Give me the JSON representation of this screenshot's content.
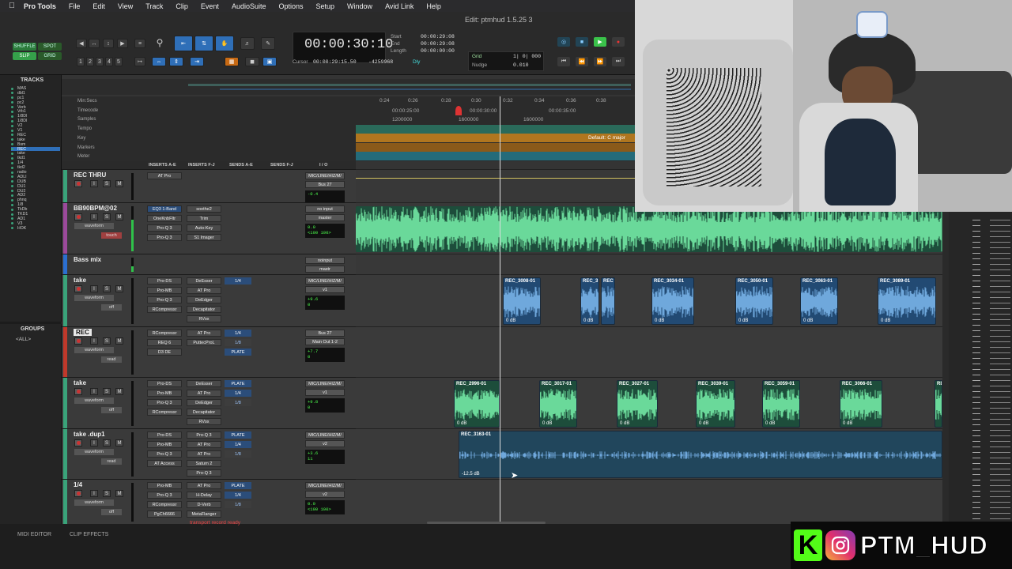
{
  "menubar": {
    "app": "Pro Tools",
    "items": [
      "File",
      "Edit",
      "View",
      "Track",
      "Clip",
      "Event",
      "AudioSuite",
      "Options",
      "Setup",
      "Window",
      "Avid Link",
      "Help"
    ]
  },
  "window": {
    "title": "Edit: ptmhud 1.5.25 3"
  },
  "toolbar": {
    "modes": [
      "SHUFFLE",
      "SPOT",
      "SLIP",
      "GRID"
    ],
    "zoom_presets": [
      "1",
      "2",
      "3",
      "4",
      "5"
    ],
    "main_counter": "00:00:30:10",
    "start_label": "Start",
    "start_value": "00:00:29:08",
    "end_label": "End",
    "end_value": "00:00:29:08",
    "length_label": "Length",
    "length_value": "00:00:00:00",
    "cursor_label": "Cursor",
    "cursor_value": "00:00:29:15.50",
    "sample_value": "-4259968",
    "dly_label": "Dly",
    "grid_label": "Grid",
    "grid_value": "1| 0| 000",
    "nudge_label": "Nudge",
    "nudge_value": "0.010"
  },
  "rulers": {
    "labels": [
      "Min:Secs",
      "Timecode",
      "Samples",
      "Tempo",
      "Key",
      "Markers",
      "Meter"
    ],
    "minsecs_ticks": [
      "0:24",
      "0:26",
      "0:28",
      "0:30",
      "0:32",
      "0:34",
      "0:36",
      "0:38"
    ],
    "timecode_ticks": [
      "00:00:25:00",
      "00:00:30:00",
      "00:00:35:00"
    ],
    "sample_ticks": [
      "1200000",
      "1600000",
      "1600000"
    ],
    "key_text": "Default: C major"
  },
  "column_headers": [
    "INSERTS A-E",
    "INSERTS F-J",
    "SENDS A-E",
    "SENDS F-J",
    "I / O"
  ],
  "panels": {
    "tracks": "TRACKS",
    "groups": "GROUPS",
    "groups_all": "<ALL>"
  },
  "track_list": [
    "MAS",
    "dbl1",
    "pc1",
    "pc2",
    "Verb",
    "Vrb1",
    "1/8DI",
    "1/8DI",
    "V2",
    "V1",
    "REC",
    "take",
    "Bsm",
    "REC",
    "take",
    "tkd1",
    "1/4",
    "tkd2",
    "radio",
    "ADLI",
    "DUB",
    "DU1",
    "DU2",
    "AD2",
    "phnq",
    "1/8",
    "TkDb",
    "TKD1",
    "AD1",
    "V3",
    "HOK"
  ],
  "tracks": [
    {
      "name": "REC THRU",
      "io_in": "MIC/LINE/HIZ/M/",
      "io_out": "Bus 27",
      "vol": "-0.4",
      "pan": "",
      "inserts": [
        "AT Pro"
      ],
      "inserts2": [],
      "color": "#3aa37a"
    },
    {
      "name": "BB90BPM@02",
      "io_in": "no input",
      "io_out": "master",
      "vol": "0.0",
      "pan": "<100  100>",
      "inserts": [
        "EQ3 1-Band",
        "OneKnbFltr",
        "Pro-Q 3",
        "Pro-Q 3"
      ],
      "inserts2": [
        "soothe2",
        "Trim",
        "Auto-Key",
        "S1 Imager"
      ],
      "color": "#9b4a9b",
      "view": "waveform",
      "auto": "touch"
    },
    {
      "name": "Bass mix",
      "io_in": "noinput",
      "io_out": "mastr",
      "vol": "0.0",
      "pan": "",
      "inserts": [],
      "inserts2": [],
      "color": "#2b6fd1",
      "view": "wave",
      "auto": "touch"
    },
    {
      "name": "take",
      "io_in": "MIC/LINE/HIZ/M/",
      "io_out": "v1",
      "vol": "+9.6",
      "pan": "0",
      "inserts": [
        "Pro-DS",
        "Pro-MB",
        "Pro-Q 3",
        "RCompressr"
      ],
      "inserts2": [
        "DeEsser",
        "AT Pro",
        "DeEdger",
        "Decapitator",
        "RVox"
      ],
      "sends": [
        "1/4"
      ],
      "color": "#3aa37a",
      "view": "waveform",
      "auto": "off"
    },
    {
      "name": "REC",
      "io_in": "Bus 27",
      "io_out": "Main Out 1-2",
      "vol": "+7.7",
      "pan": "0",
      "inserts": [
        "RCompressr",
        "REQ 6",
        "D3 DE"
      ],
      "inserts2": [
        "AT Pro",
        "PuttecProL"
      ],
      "sends": [
        "1/4",
        "1/8",
        "PLATE"
      ],
      "color": "#c0392b",
      "view": "waveform",
      "auto": "read"
    },
    {
      "name": "take",
      "io_in": "MIC/LINE/HIZ/M/",
      "io_out": "v1",
      "vol": "+9.8",
      "pan": "0",
      "inserts": [
        "Pro-DS",
        "Pro-MB",
        "Pro-Q 3",
        "RCompressr"
      ],
      "inserts2": [
        "DeEsser",
        "AT Pro",
        "DeEdger",
        "Decapitator",
        "RVox"
      ],
      "sends": [
        "PLATE",
        "1/4",
        "1/8"
      ],
      "color": "#3aa37a",
      "view": "waveform",
      "auto": "off"
    },
    {
      "name": "take .dup1",
      "io_in": "MIC/LINE/HIZ/M/",
      "io_out": "v2",
      "vol": "+3.6",
      "pan": "11",
      "inserts": [
        "Pro-DS",
        "Pro-MB",
        "Pro-Q 3",
        "AT Access"
      ],
      "inserts2": [
        "Pro-Q 3",
        "AT Pro",
        "AT Pro",
        "Saturn 2",
        "Pro-Q 3"
      ],
      "sends": [
        "PLATE",
        "1/4",
        "1/8"
      ],
      "color": "#3aa37a",
      "view": "waveform",
      "auto": "read"
    },
    {
      "name": "1/4",
      "io_in": "MIC/LINE/HIZ/M/",
      "io_out": "v2",
      "vol": "0.0",
      "pan": "<100  100>",
      "inserts": [
        "Pro-MB",
        "Pro-Q 3",
        "RCompressr",
        "PgCh6666"
      ],
      "inserts2": [
        "AT Pro",
        "H-Delay",
        "D-Verb",
        "MetaFlanger"
      ],
      "sends": [
        "PLATE",
        "1/4",
        "1/8"
      ],
      "color": "#3aa37a",
      "view": "waveform",
      "auto": "off"
    }
  ],
  "lane_clips": {
    "take": [
      {
        "name": "REC_3008-01",
        "gain": "0 dB"
      },
      {
        "name": "REC_3",
        "gain": "0 dB"
      },
      {
        "name": "REC",
        "gain": ""
      },
      {
        "name": "REC_3034-01",
        "gain": "0 dB"
      },
      {
        "name": "REC_3050-01",
        "gain": "0 dB"
      },
      {
        "name": "REC_3063-01",
        "gain": "0 dB"
      },
      {
        "name": "REC_3089-01",
        "gain": "0 dB"
      }
    ],
    "take2": [
      {
        "name": "REC_2996-01",
        "gain": "0 dB"
      },
      {
        "name": "REC_3017-01",
        "gain": "0 dB"
      },
      {
        "name": "REC_3027-01",
        "gain": "0 dB"
      },
      {
        "name": "REC_3039-01",
        "gain": "0 dB"
      },
      {
        "name": "REC_3059-01",
        "gain": "0 dB"
      },
      {
        "name": "REC_3066-01",
        "gain": "0 dB"
      },
      {
        "name": "RE",
        "gain": ""
      }
    ],
    "dup": {
      "name": "REC_3163-01",
      "gain": "-12.5 dB"
    }
  },
  "status": {
    "transport": "transport record ready"
  },
  "bottom_tabs": [
    "MIDI EDITOR",
    "CLIP EFFECTS"
  ],
  "overlay": {
    "handle": "PTM_HUD",
    "kick_letter": "K"
  },
  "colors": {
    "accent": "#2f6fb8",
    "clip_blue": "#224a73",
    "clip_green": "#1d4d3b",
    "wave_blue": "#6fa8dc",
    "wave_green": "#6ad99a"
  }
}
